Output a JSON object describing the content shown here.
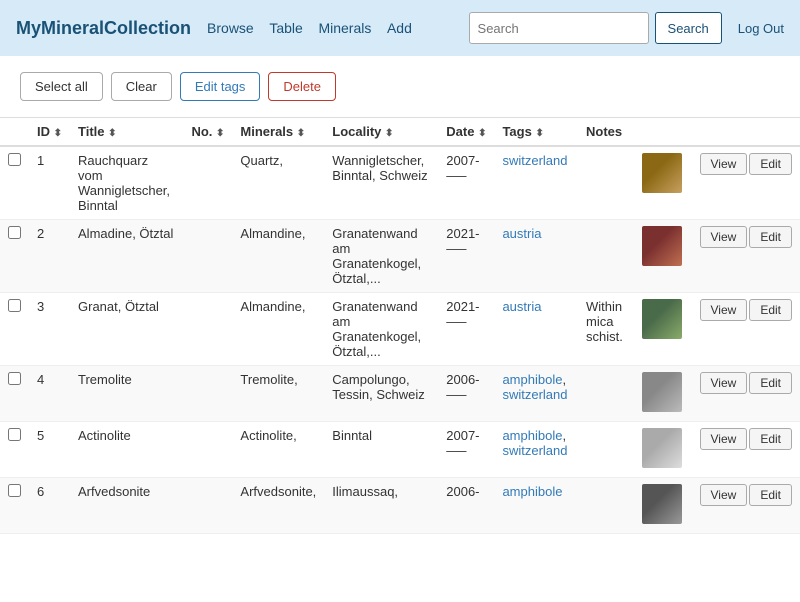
{
  "header": {
    "brand": "MyMineralCollection",
    "nav": [
      {
        "label": "Browse",
        "href": "#"
      },
      {
        "label": "Table",
        "href": "#"
      },
      {
        "label": "Minerals",
        "href": "#"
      },
      {
        "label": "Add",
        "href": "#"
      }
    ],
    "search_placeholder": "Search",
    "search_button": "Search",
    "logout": "Log Out"
  },
  "toolbar": {
    "select_all": "Select all",
    "clear": "Clear",
    "edit_tags": "Edit tags",
    "delete": "Delete"
  },
  "table": {
    "columns": [
      {
        "label": "ID",
        "sort": true
      },
      {
        "label": "Title",
        "sort": true
      },
      {
        "label": "No.",
        "sort": true
      },
      {
        "label": "Minerals",
        "sort": true
      },
      {
        "label": "Locality",
        "sort": true
      },
      {
        "label": "Date",
        "sort": true
      },
      {
        "label": "Tags",
        "sort": true
      },
      {
        "label": "Notes",
        "sort": false
      }
    ],
    "rows": [
      {
        "id": 1,
        "title": "Rauchquarz vom Wannigletscher, Binntal",
        "no": "",
        "minerals": "Quartz,",
        "locality": "Wannigletscher, Binntal, Schweiz",
        "date": "2007-\n–—",
        "tags": [
          {
            "label": "switzerland",
            "href": "#"
          }
        ],
        "notes": "",
        "img_class": "img-smoke"
      },
      {
        "id": 2,
        "title": "Almadine, Ötztal",
        "no": "",
        "minerals": "Almandine,",
        "locality": "Granatenwand am Granatenkogel, Ötztal,...",
        "date": "2021-\n–—",
        "tags": [
          {
            "label": "austria",
            "href": "#"
          }
        ],
        "notes": "",
        "img_class": "img-red"
      },
      {
        "id": 3,
        "title": "Granat, Ötztal",
        "no": "",
        "minerals": "Almandine,",
        "locality": "Granatenwand am Granatenkogel, Ötztal,...",
        "date": "2021-\n–—",
        "tags": [
          {
            "label": "austria",
            "href": "#"
          }
        ],
        "notes": "Within mica schist.",
        "img_class": "img-green"
      },
      {
        "id": 4,
        "title": "Tremolite",
        "no": "",
        "minerals": "Tremolite,",
        "locality": "Campolungo, Tessin, Schweiz",
        "date": "2006-\n–—",
        "tags": [
          {
            "label": "amphibole",
            "href": "#"
          },
          {
            "label": "switzerland",
            "href": "#"
          }
        ],
        "notes": "",
        "img_class": "img-gray"
      },
      {
        "id": 5,
        "title": "Actinolite",
        "no": "",
        "minerals": "Actinolite,",
        "locality": "Binntal",
        "date": "2007-\n–—",
        "tags": [
          {
            "label": "amphibole",
            "href": "#"
          },
          {
            "label": "switzerland",
            "href": "#"
          }
        ],
        "notes": "",
        "img_class": "img-silver"
      },
      {
        "id": 6,
        "title": "Arfvedsonite",
        "no": "",
        "minerals": "Arfvedsonite,",
        "locality": "Ilimaussaq,",
        "date": "2006-",
        "tags": [
          {
            "label": "amphibole",
            "href": "#"
          }
        ],
        "notes": "",
        "img_class": "img-dark"
      }
    ]
  }
}
